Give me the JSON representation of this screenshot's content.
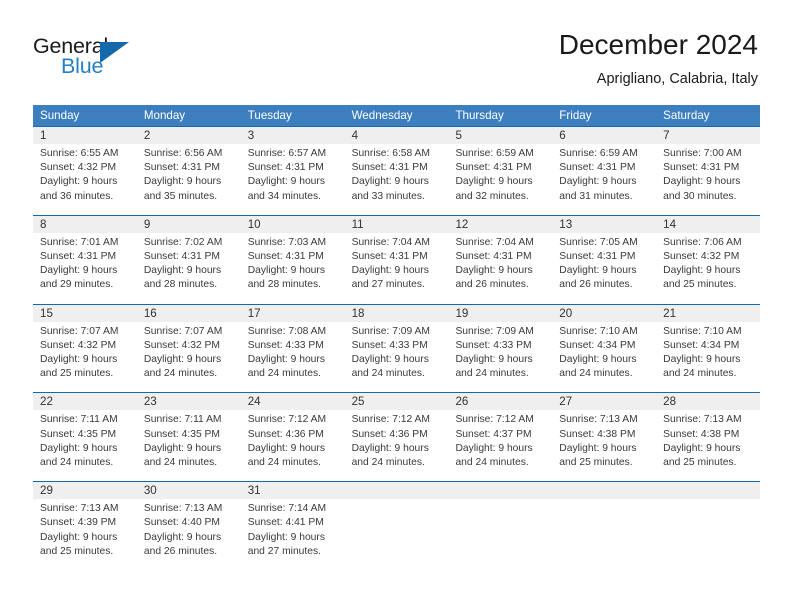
{
  "brand": {
    "name_part1": "General",
    "name_part2": "Blue",
    "logo_icon": "triangle-icon",
    "accent_color": "#2580c3",
    "triangle_color": "#1668ad"
  },
  "header": {
    "title": "December 2024",
    "subtitle": "Aprigliano, Calabria, Italy"
  },
  "calendar": {
    "header_bg_color": "#3d7ebf",
    "row_divider_color": "#1668ad",
    "day_number_bg_color": "#efefef",
    "weekdays": [
      "Sunday",
      "Monday",
      "Tuesday",
      "Wednesday",
      "Thursday",
      "Friday",
      "Saturday"
    ],
    "weeks": [
      [
        {
          "day": "1",
          "sunrise": "Sunrise: 6:55 AM",
          "sunset": "Sunset: 4:32 PM",
          "daylight_line1": "Daylight: 9 hours",
          "daylight_line2": "and 36 minutes."
        },
        {
          "day": "2",
          "sunrise": "Sunrise: 6:56 AM",
          "sunset": "Sunset: 4:31 PM",
          "daylight_line1": "Daylight: 9 hours",
          "daylight_line2": "and 35 minutes."
        },
        {
          "day": "3",
          "sunrise": "Sunrise: 6:57 AM",
          "sunset": "Sunset: 4:31 PM",
          "daylight_line1": "Daylight: 9 hours",
          "daylight_line2": "and 34 minutes."
        },
        {
          "day": "4",
          "sunrise": "Sunrise: 6:58 AM",
          "sunset": "Sunset: 4:31 PM",
          "daylight_line1": "Daylight: 9 hours",
          "daylight_line2": "and 33 minutes."
        },
        {
          "day": "5",
          "sunrise": "Sunrise: 6:59 AM",
          "sunset": "Sunset: 4:31 PM",
          "daylight_line1": "Daylight: 9 hours",
          "daylight_line2": "and 32 minutes."
        },
        {
          "day": "6",
          "sunrise": "Sunrise: 6:59 AM",
          "sunset": "Sunset: 4:31 PM",
          "daylight_line1": "Daylight: 9 hours",
          "daylight_line2": "and 31 minutes."
        },
        {
          "day": "7",
          "sunrise": "Sunrise: 7:00 AM",
          "sunset": "Sunset: 4:31 PM",
          "daylight_line1": "Daylight: 9 hours",
          "daylight_line2": "and 30 minutes."
        }
      ],
      [
        {
          "day": "8",
          "sunrise": "Sunrise: 7:01 AM",
          "sunset": "Sunset: 4:31 PM",
          "daylight_line1": "Daylight: 9 hours",
          "daylight_line2": "and 29 minutes."
        },
        {
          "day": "9",
          "sunrise": "Sunrise: 7:02 AM",
          "sunset": "Sunset: 4:31 PM",
          "daylight_line1": "Daylight: 9 hours",
          "daylight_line2": "and 28 minutes."
        },
        {
          "day": "10",
          "sunrise": "Sunrise: 7:03 AM",
          "sunset": "Sunset: 4:31 PM",
          "daylight_line1": "Daylight: 9 hours",
          "daylight_line2": "and 28 minutes."
        },
        {
          "day": "11",
          "sunrise": "Sunrise: 7:04 AM",
          "sunset": "Sunset: 4:31 PM",
          "daylight_line1": "Daylight: 9 hours",
          "daylight_line2": "and 27 minutes."
        },
        {
          "day": "12",
          "sunrise": "Sunrise: 7:04 AM",
          "sunset": "Sunset: 4:31 PM",
          "daylight_line1": "Daylight: 9 hours",
          "daylight_line2": "and 26 minutes."
        },
        {
          "day": "13",
          "sunrise": "Sunrise: 7:05 AM",
          "sunset": "Sunset: 4:31 PM",
          "daylight_line1": "Daylight: 9 hours",
          "daylight_line2": "and 26 minutes."
        },
        {
          "day": "14",
          "sunrise": "Sunrise: 7:06 AM",
          "sunset": "Sunset: 4:32 PM",
          "daylight_line1": "Daylight: 9 hours",
          "daylight_line2": "and 25 minutes."
        }
      ],
      [
        {
          "day": "15",
          "sunrise": "Sunrise: 7:07 AM",
          "sunset": "Sunset: 4:32 PM",
          "daylight_line1": "Daylight: 9 hours",
          "daylight_line2": "and 25 minutes."
        },
        {
          "day": "16",
          "sunrise": "Sunrise: 7:07 AM",
          "sunset": "Sunset: 4:32 PM",
          "daylight_line1": "Daylight: 9 hours",
          "daylight_line2": "and 24 minutes."
        },
        {
          "day": "17",
          "sunrise": "Sunrise: 7:08 AM",
          "sunset": "Sunset: 4:33 PM",
          "daylight_line1": "Daylight: 9 hours",
          "daylight_line2": "and 24 minutes."
        },
        {
          "day": "18",
          "sunrise": "Sunrise: 7:09 AM",
          "sunset": "Sunset: 4:33 PM",
          "daylight_line1": "Daylight: 9 hours",
          "daylight_line2": "and 24 minutes."
        },
        {
          "day": "19",
          "sunrise": "Sunrise: 7:09 AM",
          "sunset": "Sunset: 4:33 PM",
          "daylight_line1": "Daylight: 9 hours",
          "daylight_line2": "and 24 minutes."
        },
        {
          "day": "20",
          "sunrise": "Sunrise: 7:10 AM",
          "sunset": "Sunset: 4:34 PM",
          "daylight_line1": "Daylight: 9 hours",
          "daylight_line2": "and 24 minutes."
        },
        {
          "day": "21",
          "sunrise": "Sunrise: 7:10 AM",
          "sunset": "Sunset: 4:34 PM",
          "daylight_line1": "Daylight: 9 hours",
          "daylight_line2": "and 24 minutes."
        }
      ],
      [
        {
          "day": "22",
          "sunrise": "Sunrise: 7:11 AM",
          "sunset": "Sunset: 4:35 PM",
          "daylight_line1": "Daylight: 9 hours",
          "daylight_line2": "and 24 minutes."
        },
        {
          "day": "23",
          "sunrise": "Sunrise: 7:11 AM",
          "sunset": "Sunset: 4:35 PM",
          "daylight_line1": "Daylight: 9 hours",
          "daylight_line2": "and 24 minutes."
        },
        {
          "day": "24",
          "sunrise": "Sunrise: 7:12 AM",
          "sunset": "Sunset: 4:36 PM",
          "daylight_line1": "Daylight: 9 hours",
          "daylight_line2": "and 24 minutes."
        },
        {
          "day": "25",
          "sunrise": "Sunrise: 7:12 AM",
          "sunset": "Sunset: 4:36 PM",
          "daylight_line1": "Daylight: 9 hours",
          "daylight_line2": "and 24 minutes."
        },
        {
          "day": "26",
          "sunrise": "Sunrise: 7:12 AM",
          "sunset": "Sunset: 4:37 PM",
          "daylight_line1": "Daylight: 9 hours",
          "daylight_line2": "and 24 minutes."
        },
        {
          "day": "27",
          "sunrise": "Sunrise: 7:13 AM",
          "sunset": "Sunset: 4:38 PM",
          "daylight_line1": "Daylight: 9 hours",
          "daylight_line2": "and 25 minutes."
        },
        {
          "day": "28",
          "sunrise": "Sunrise: 7:13 AM",
          "sunset": "Sunset: 4:38 PM",
          "daylight_line1": "Daylight: 9 hours",
          "daylight_line2": "and 25 minutes."
        }
      ],
      [
        {
          "day": "29",
          "sunrise": "Sunrise: 7:13 AM",
          "sunset": "Sunset: 4:39 PM",
          "daylight_line1": "Daylight: 9 hours",
          "daylight_line2": "and 25 minutes."
        },
        {
          "day": "30",
          "sunrise": "Sunrise: 7:13 AM",
          "sunset": "Sunset: 4:40 PM",
          "daylight_line1": "Daylight: 9 hours",
          "daylight_line2": "and 26 minutes."
        },
        {
          "day": "31",
          "sunrise": "Sunrise: 7:14 AM",
          "sunset": "Sunset: 4:41 PM",
          "daylight_line1": "Daylight: 9 hours",
          "daylight_line2": "and 27 minutes."
        },
        {
          "day": "",
          "sunrise": "",
          "sunset": "",
          "daylight_line1": "",
          "daylight_line2": ""
        },
        {
          "day": "",
          "sunrise": "",
          "sunset": "",
          "daylight_line1": "",
          "daylight_line2": ""
        },
        {
          "day": "",
          "sunrise": "",
          "sunset": "",
          "daylight_line1": "",
          "daylight_line2": ""
        },
        {
          "day": "",
          "sunrise": "",
          "sunset": "",
          "daylight_line1": "",
          "daylight_line2": ""
        }
      ]
    ]
  }
}
